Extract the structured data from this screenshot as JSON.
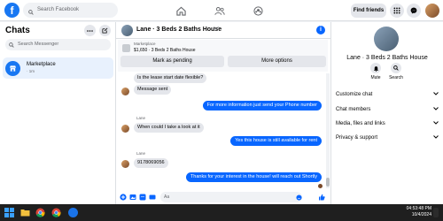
{
  "topbar": {
    "logo": "f",
    "search_placeholder": "Search Facebook",
    "find_friends": "Find friends"
  },
  "left": {
    "title": "Chats",
    "search_placeholder": "Search Messenger",
    "chat_item": {
      "name": "Marketplace",
      "sub": "· 1m"
    }
  },
  "conversation": {
    "title": "Lane · 3 Beds 2 Baths House",
    "listing": {
      "source": "Marketplace",
      "price_line": "$1,650 · 3 Beds 2 Baths House"
    },
    "mark_pending": "Mark as pending",
    "more_options": "More options",
    "messages": [
      {
        "dir": "in",
        "text": "Is the lease start date flexible?"
      },
      {
        "dir": "in",
        "text": "Message sent"
      },
      {
        "dir": "out",
        "text": "For more information just send your Phone number"
      },
      {
        "dir": "in",
        "sender": "Lane",
        "text": "When could I take a look at it"
      },
      {
        "dir": "out",
        "text": "Yes this house is still available for rent"
      },
      {
        "dir": "in",
        "sender": "Lane",
        "text": "9178069056"
      },
      {
        "dir": "out",
        "text": "Thanks for your interest in the house! will reach out Shortly"
      }
    ],
    "composer_value": "Aa"
  },
  "right": {
    "name": "Lane · 3 Beds 2 Baths House",
    "mute": "Mute",
    "search": "Search",
    "rows": [
      "Customize chat",
      "Chat members",
      "Media, files and links",
      "Privacy & support"
    ]
  },
  "taskbar": {
    "time": "04:53:48 PM",
    "date": "10/4/2024"
  },
  "colors": {
    "brand": "#1877f2",
    "outgoing": "#0866ff",
    "incoming": "#e4e6eb"
  }
}
